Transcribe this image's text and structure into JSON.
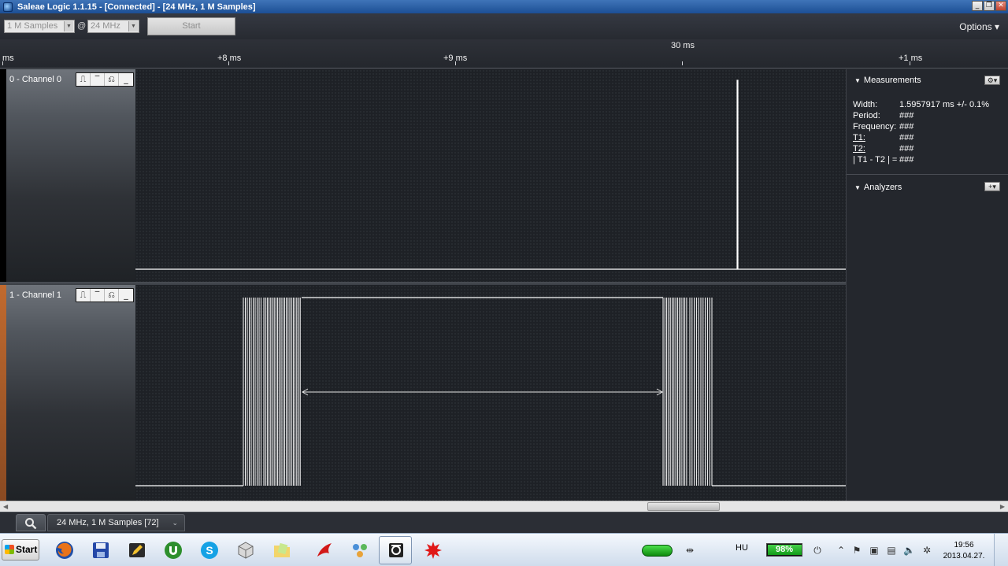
{
  "window": {
    "title": "Saleae Logic 1.1.15 - [Connected] - [24 MHz, 1 M Samples]",
    "minimize": "_",
    "restore": "❐",
    "close": "✕"
  },
  "toolbar": {
    "samples_value": "1 M Samples",
    "at_label": "@",
    "rate_value": "24 MHz",
    "start_label": "Start",
    "options_label": "Options ▾"
  },
  "ruler": {
    "ticks": [
      "ms",
      "+8 ms",
      "+9 ms",
      "+1 ms"
    ],
    "center_label": "30 ms"
  },
  "channels": [
    {
      "name": "0 - Channel 0",
      "color": "#000000",
      "trigger_icons": [
        "rising-edge-icon",
        "high-level-icon",
        "falling-edge-icon",
        "low-level-icon"
      ]
    },
    {
      "name": "1 - Channel 1",
      "color": "#a8582a",
      "trigger_icons": [
        "rising-edge-icon",
        "high-level-icon",
        "falling-edge-icon",
        "low-level-icon"
      ]
    }
  ],
  "measurements": {
    "header": "Measurements",
    "rows": [
      {
        "key": "Width:",
        "value": "1.5957917 ms +/- 0.1%"
      },
      {
        "key": "Period:",
        "value": "###"
      },
      {
        "key": "Frequency:",
        "value": "###"
      },
      {
        "key": "T1:",
        "value": "###"
      },
      {
        "key": "T2:",
        "value": "###"
      },
      {
        "key": "| T1 - T2 | =",
        "value": "###"
      }
    ]
  },
  "analyzers": {
    "header": "Analyzers",
    "add_label": "+▾"
  },
  "tabs": {
    "search_icon": "search-icon",
    "capture_tab": "24 MHz, 1 M Samples [72]"
  },
  "taskbar": {
    "start_label": "Start",
    "apps": [
      "firefox-icon",
      "save-disk-icon",
      "pencil-app-icon",
      "utorrent-icon",
      "skype-icon",
      "cube-app-icon",
      "folder-notes-icon",
      "red-bird-icon",
      "network-people-icon",
      "logic-analyzer-icon",
      "red-splat-icon"
    ],
    "language": "HU",
    "battery_percent": "98%",
    "battery_level": 0.98,
    "time": "19:56",
    "date": "2013.04.27."
  }
}
